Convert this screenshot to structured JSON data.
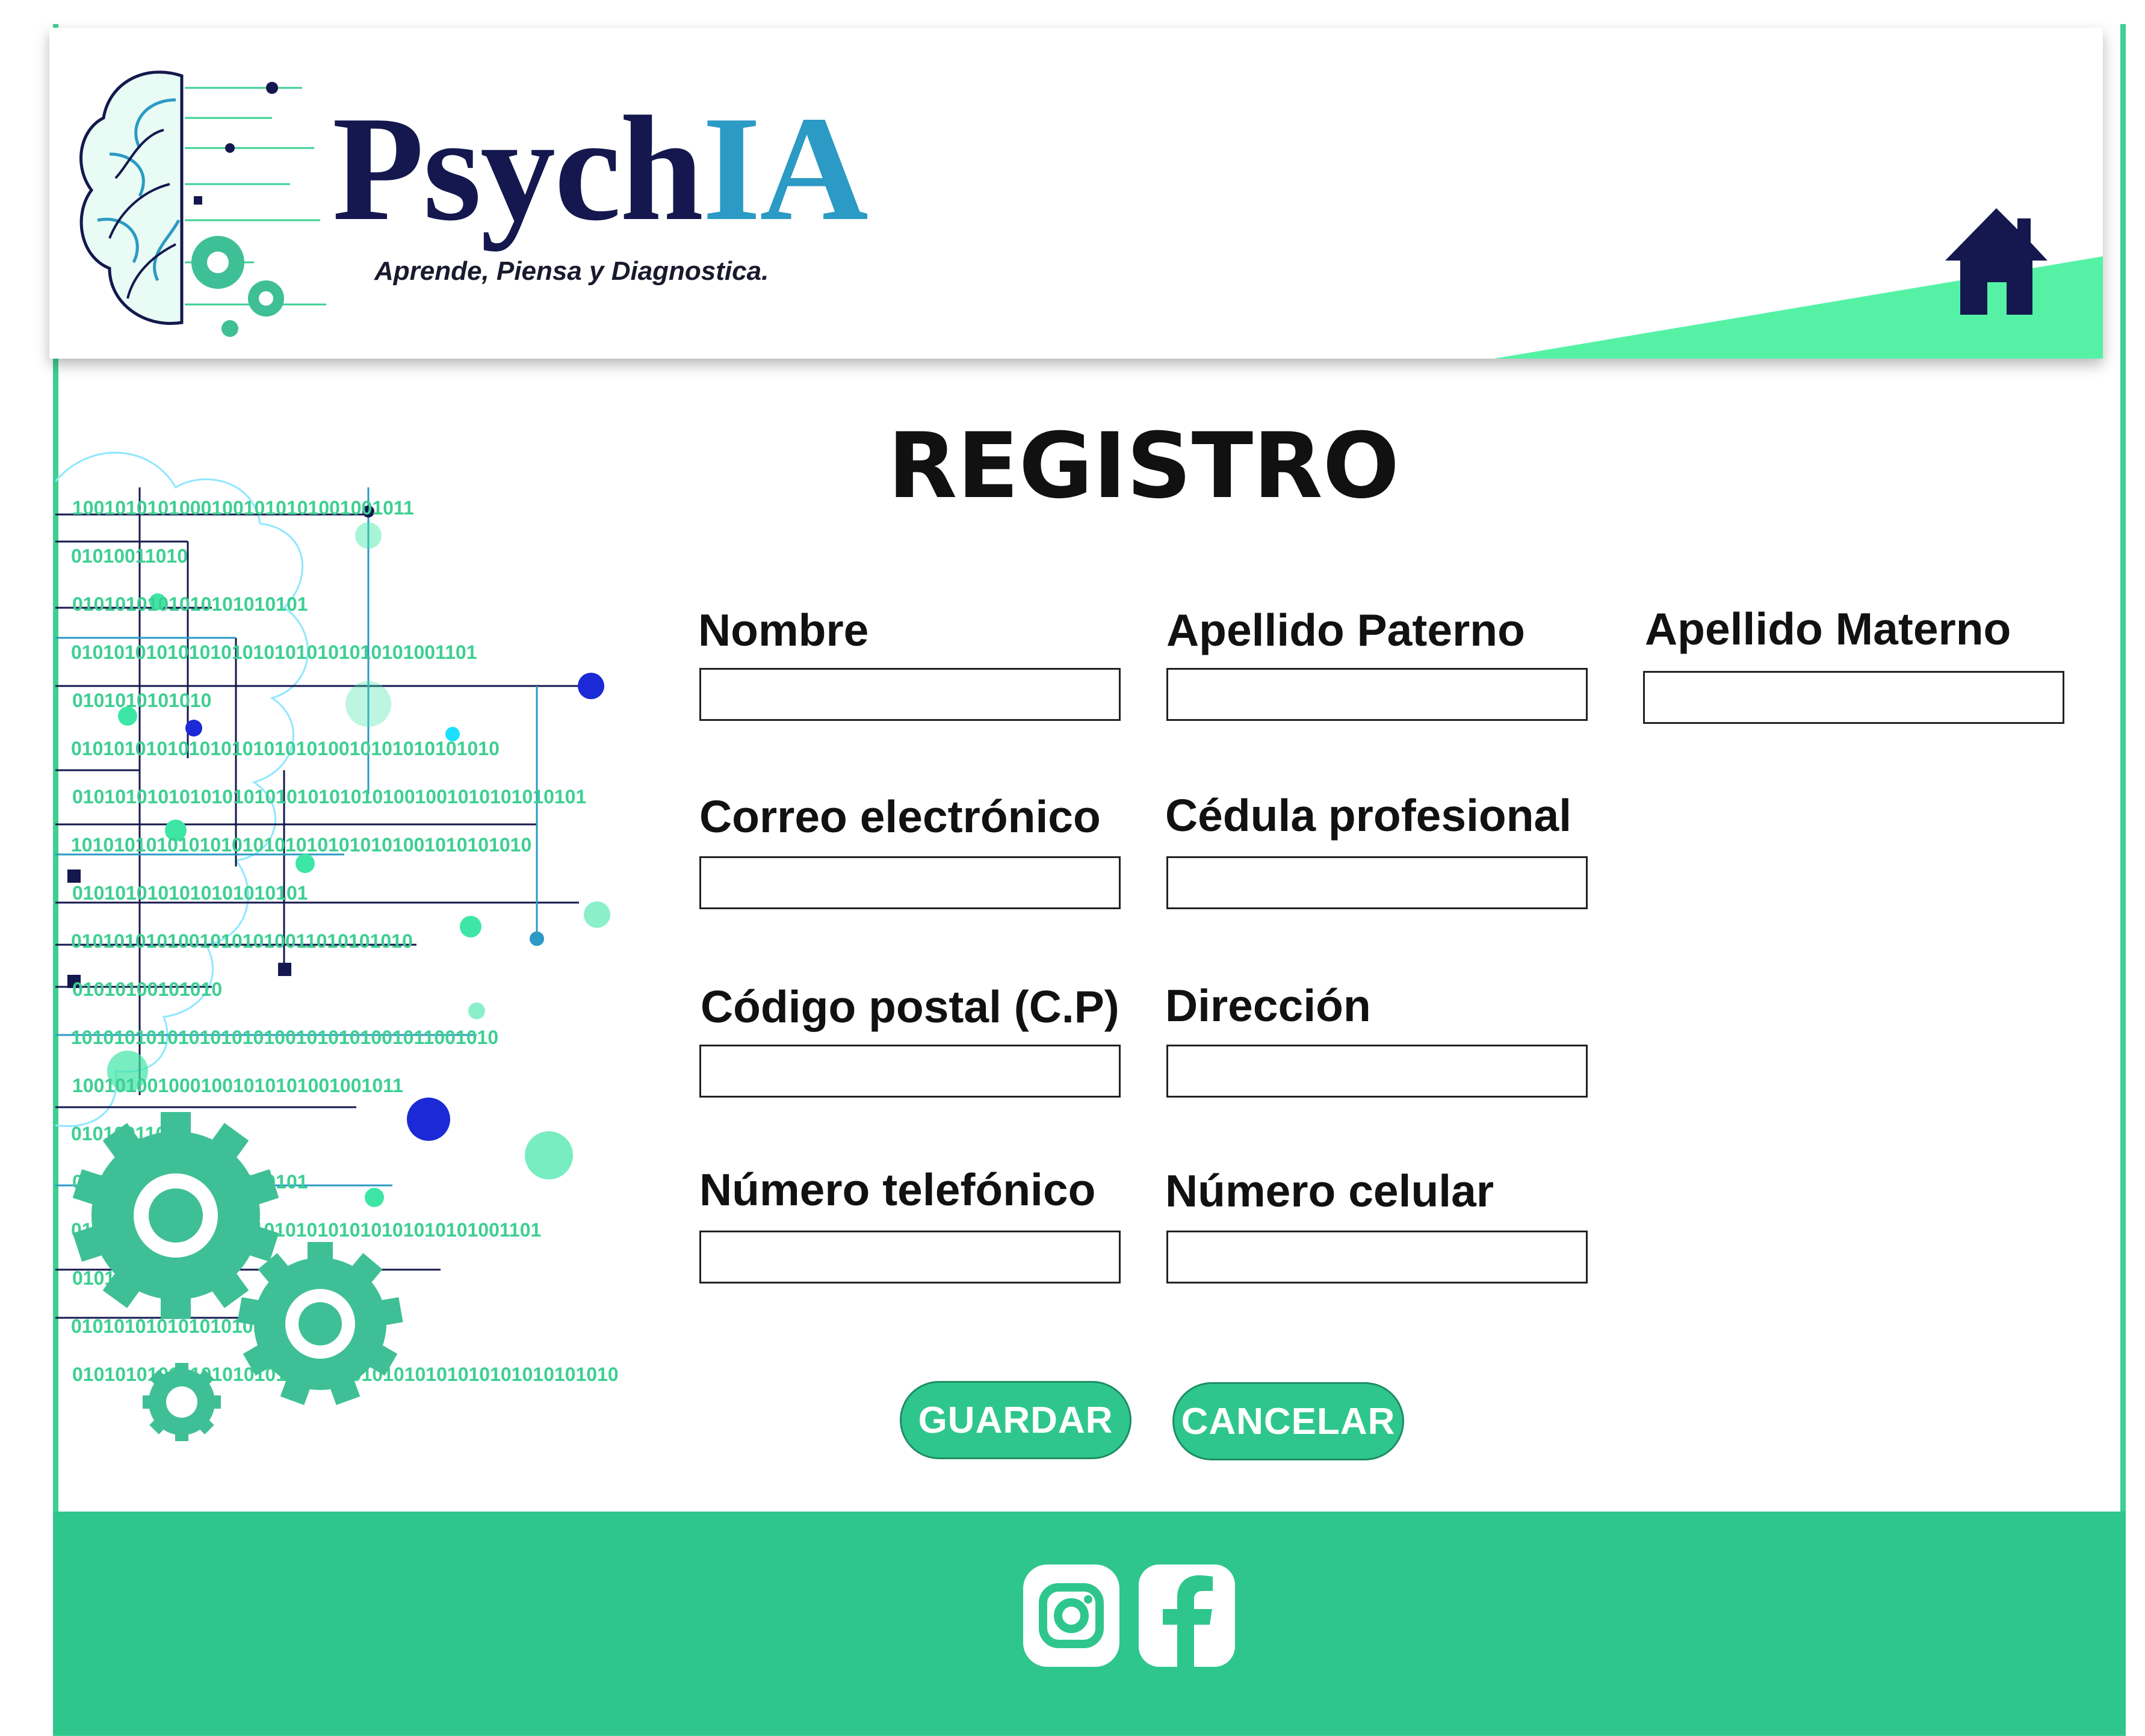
{
  "header": {
    "brand_dark": "Psych",
    "brand_accent": "IA",
    "tagline": "Aprende, Piensa y Diagnostica."
  },
  "nav": {
    "home_icon": "home-icon"
  },
  "title": "REGISTRO",
  "form": {
    "nombre": {
      "label": "Nombre",
      "value": ""
    },
    "apellido_paterno": {
      "label": "Apellido Paterno",
      "value": ""
    },
    "apellido_materno": {
      "label": "Apellido Materno",
      "value": ""
    },
    "correo": {
      "label": "Correo electrónico",
      "value": ""
    },
    "cedula": {
      "label": "Cédula profesional",
      "value": ""
    },
    "codigo_postal": {
      "label": "Código postal (C.P)",
      "value": ""
    },
    "direccion": {
      "label": "Dirección",
      "value": ""
    },
    "telefono": {
      "label": "Número telefónico",
      "value": ""
    },
    "celular": {
      "label": "Número celular",
      "value": ""
    }
  },
  "actions": {
    "save_label": "GUARDAR",
    "cancel_label": "CANCELAR"
  },
  "binary_rows": [
    "10010101010001001010101001001011",
    "01010011010",
    "0101010101010101010101",
    "01010101010101010101010101010101001101",
    "0101010101010",
    "0101010101010101010101010010101010101010",
    "010101010101010101010101010101001001010101010101",
    "1010101010101010101010101010101001010101010",
    "0101010101010101010101",
    "01010101010010101010011010101010",
    "01010100101010",
    "1010101010101010101001010101001011001010",
    "1001010010001001010101001001011",
    "01010011010",
    "0101010101010101010101",
    "01010101010101010101010101010101010101001101",
    "0101010101010",
    "0101010101010101010101010",
    "010101010101010101010101010101010101010101010101010"
  ],
  "footer": {
    "icons": [
      "instagram-icon",
      "facebook-icon"
    ]
  },
  "colors": {
    "brand_navy": "#14184e",
    "brand_blue": "#2b9ac4",
    "accent_green": "#2fc68d",
    "wedge_green": "#55f2a6"
  }
}
